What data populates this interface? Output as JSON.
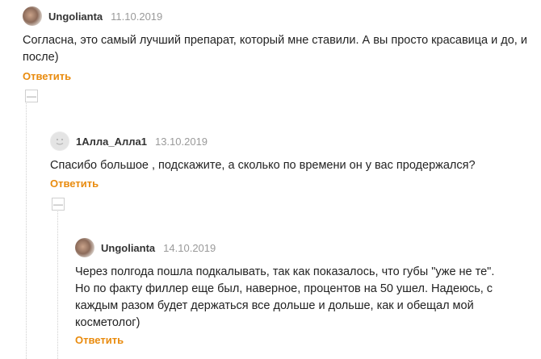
{
  "comments": [
    {
      "username": "Ungolianta",
      "date": "11.10.2019",
      "text": "Согласна, это самый лучший препарат, который мне ставили. А вы просто красавица и до, и после)",
      "reply_label": "Ответить",
      "avatar_icon": "user-photo-icon"
    },
    {
      "username": "1Алла_Алла1",
      "date": "13.10.2019",
      "text": "Спасибо большое , подскажите, а сколько по времени он у вас продержался?",
      "reply_label": "Ответить",
      "avatar_icon": "default-avatar-icon"
    },
    {
      "username": "Ungolianta",
      "date": "14.10.2019",
      "text": "Через полгода пошла подкалывать, так как показалось, что губы \"уже не те\". Но по факту филлер еще был, наверное, процентов на 50 ушел. Надеюсь, с каждым разом будет держаться все дольше и дольше, как и обещал мой косметолог)",
      "reply_label": "Ответить",
      "avatar_icon": "user-photo-icon"
    }
  ],
  "collapse_glyph": "—",
  "colors": {
    "accent": "#e98b0e",
    "date": "#9a9a9a",
    "thread_line": "#cfcfcf"
  }
}
